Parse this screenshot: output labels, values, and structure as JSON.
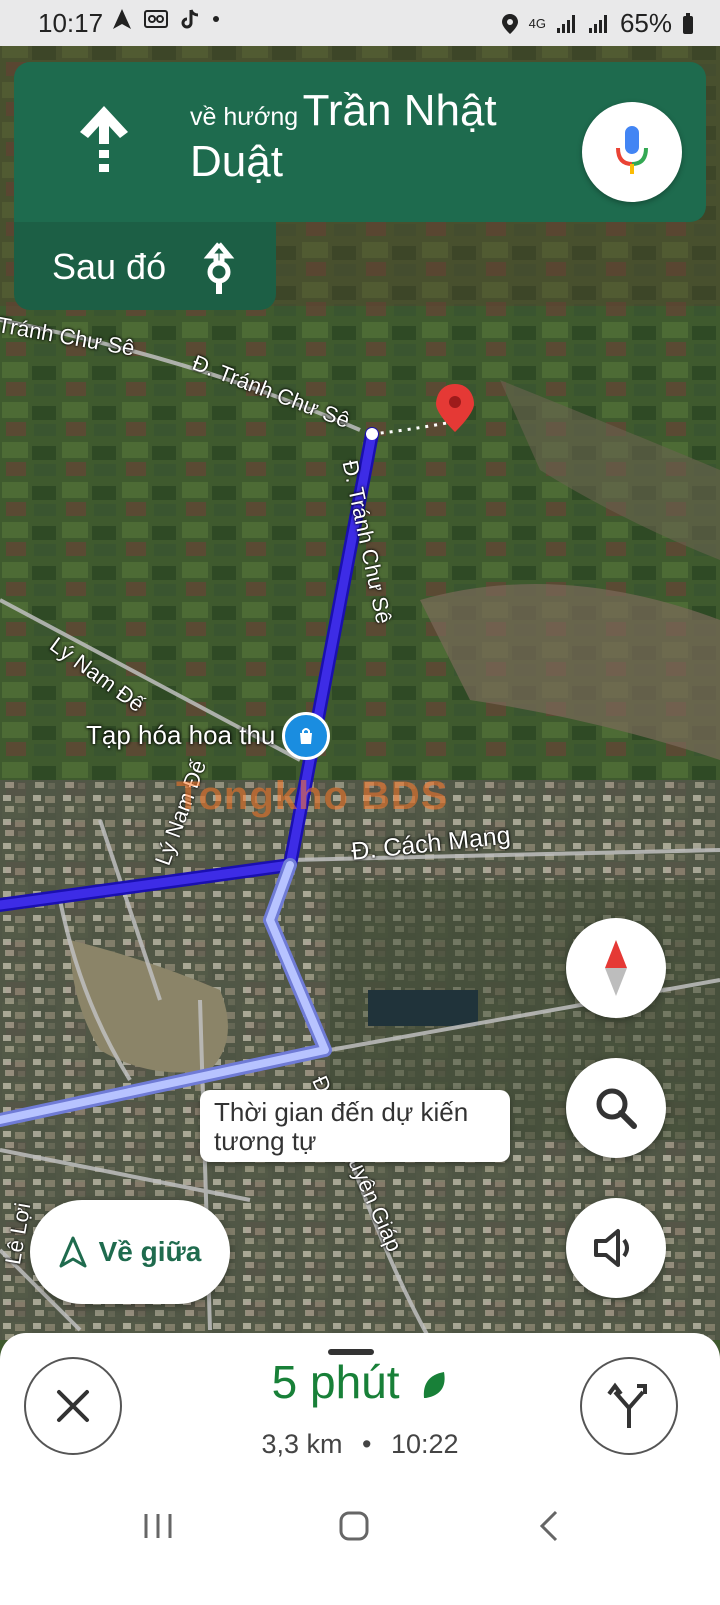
{
  "status_bar": {
    "time": "10:17",
    "battery": "65%",
    "network": "4G"
  },
  "navigation": {
    "direction_prefix": "về hướng",
    "street": "Trần Nhật Duật",
    "then_label": "Sau đó",
    "banner_color": "#1e6b4e"
  },
  "map": {
    "road_labels": {
      "tranh_chu_se_top": "Tránh Chư Sê",
      "tranh_chu_se_mid": "Đ. Tránh Chư Sê",
      "tranh_chu_se_vertical": "Đ. Tránh Chư Sê",
      "ly_nam_de_1": "Lý Nam Đế",
      "ly_nam_de_2": "Lý Nam Đế",
      "cach_mang": "Đ. Cách Mạng",
      "le_loi": "Lê Lợi",
      "to_nguyen_giap": "Đ. Võ Nguyên Giáp"
    },
    "poi_label": "Tạp hóa hoa thu",
    "watermark": "Tongkho BDS",
    "route_color": "#3d2ce6",
    "alt_route_color": "#a9b8ff"
  },
  "tooltip": {
    "text": "Thời gian đến dự kiến tương tự"
  },
  "buttons": {
    "recenter_label": "Về giữa"
  },
  "trip": {
    "duration": "5 phút",
    "distance": "3,3 km",
    "separator": "•",
    "arrival": "10:22"
  }
}
